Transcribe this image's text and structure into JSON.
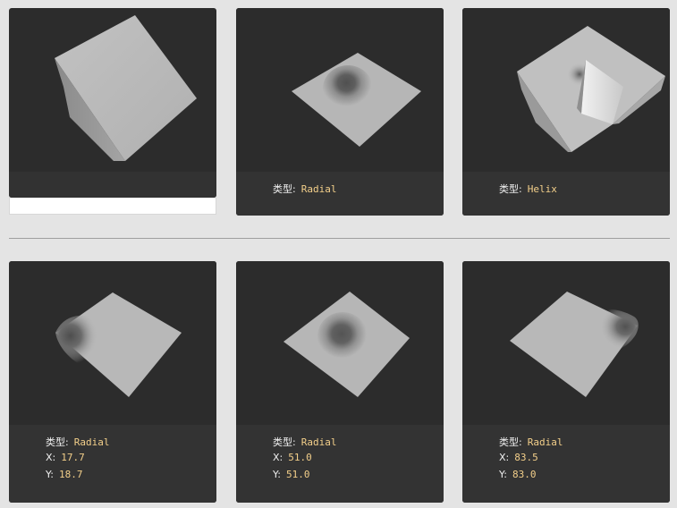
{
  "cards": [
    {
      "rows": []
    },
    {
      "rows": [
        {
          "key": "类型:",
          "value": "Radial"
        }
      ]
    },
    {
      "rows": [
        {
          "key": "类型:",
          "value": "Helix"
        }
      ]
    },
    {
      "rows": [
        {
          "key": "类型:",
          "value": "Radial"
        },
        {
          "key": "X:",
          "value": "17.7"
        },
        {
          "key": "Y:",
          "value": "18.7"
        }
      ]
    },
    {
      "rows": [
        {
          "key": "类型:",
          "value": "Radial"
        },
        {
          "key": "X:",
          "value": "51.0"
        },
        {
          "key": "Y:",
          "value": "51.0"
        }
      ]
    },
    {
      "rows": [
        {
          "key": "类型:",
          "value": "Radial"
        },
        {
          "key": "X:",
          "value": "83.5"
        },
        {
          "key": "Y:",
          "value": "83.0"
        }
      ]
    }
  ],
  "colors": {
    "card_bg": "#2c2c2c",
    "info_bg": "#333333",
    "value_color": "#f3cf8a",
    "surface": "#b4b4b4"
  }
}
